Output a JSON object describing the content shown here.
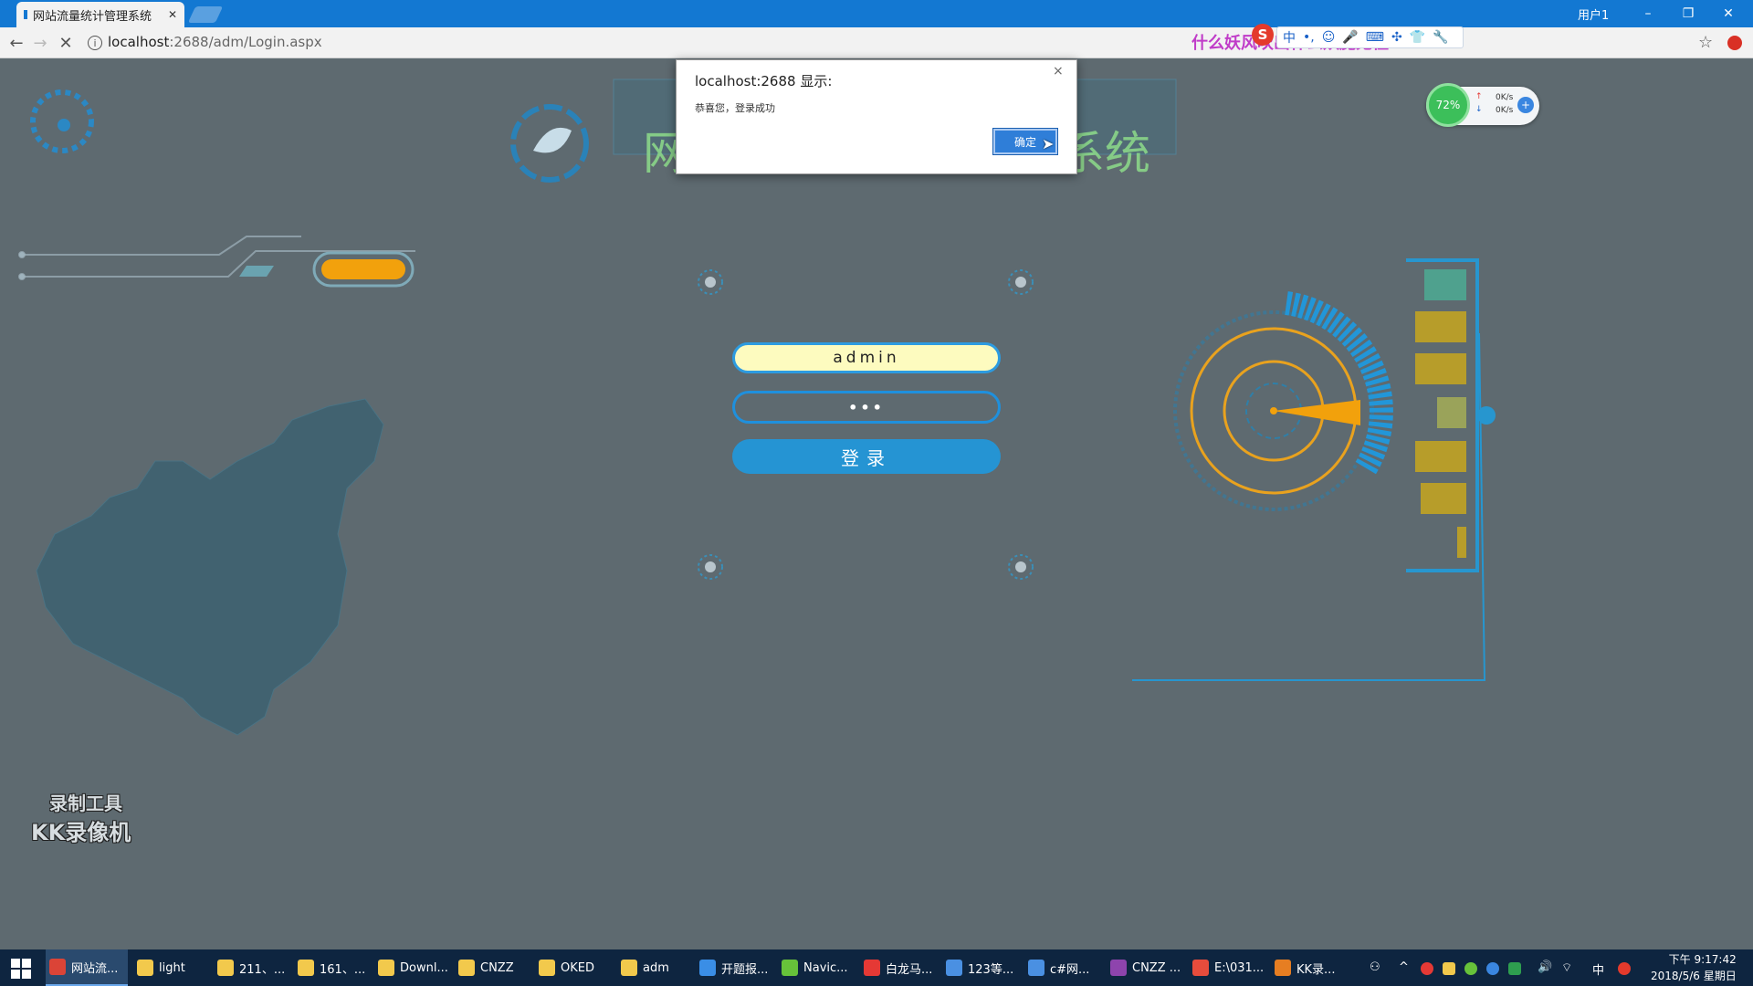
{
  "browser": {
    "tab_title": "网站流量统计管理系统",
    "tab_close": "✕",
    "user_label": "用户1",
    "window_controls": [
      "–",
      "❐",
      "✕"
    ],
    "url_host": "localhost",
    "url_path": ":2688/adm/Login.aspx",
    "ime_banner": "什么妖风吹出什么妖魔鬼怪"
  },
  "ime": {
    "logo": "S",
    "items": [
      "中",
      "•,",
      "☺",
      "🎤",
      "⌨",
      "✣",
      "👕",
      "🔧"
    ]
  },
  "dialog": {
    "title": "localhost:2688 显示:",
    "message": "恭喜您，登录成功",
    "close": "×",
    "ok_label": "确定"
  },
  "page": {
    "heading_left": "网",
    "heading_right": "系统"
  },
  "login": {
    "username": "admin",
    "password_mask": "•••",
    "submit_label": "登录"
  },
  "netmeter": {
    "cpu": "72%",
    "up_rate": "0K/s",
    "down_rate": "0K/s"
  },
  "watermark": {
    "line1": "录制工具",
    "line2": "KK录像机"
  },
  "taskbar": {
    "items": [
      {
        "label": "网站流...",
        "color": "#db4437"
      },
      {
        "label": "light",
        "color": "#f2c94c"
      },
      {
        "label": "211、...",
        "color": "#f2c94c"
      },
      {
        "label": "161、...",
        "color": "#f2c94c"
      },
      {
        "label": "Downl...",
        "color": "#f2c94c"
      },
      {
        "label": "CNZZ",
        "color": "#f2c94c"
      },
      {
        "label": "OKED",
        "color": "#f2c94c"
      },
      {
        "label": "adm",
        "color": "#f2c94c"
      },
      {
        "label": "开题报...",
        "color": "#3a8ee6"
      },
      {
        "label": "Navic...",
        "color": "#67c23a"
      },
      {
        "label": "白龙马...",
        "color": "#e53935"
      },
      {
        "label": "123等...",
        "color": "#4a90e2"
      },
      {
        "label": "c#网...",
        "color": "#4a90e2"
      },
      {
        "label": "CNZZ ...",
        "color": "#8e44ad"
      },
      {
        "label": "E:\\031...",
        "color": "#e74c3c"
      },
      {
        "label": "KK录...",
        "color": "#e67e22"
      }
    ],
    "tray_lang": "中",
    "clock_time": "下午 9:17:42",
    "clock_date": "2018/5/6 星期日"
  }
}
